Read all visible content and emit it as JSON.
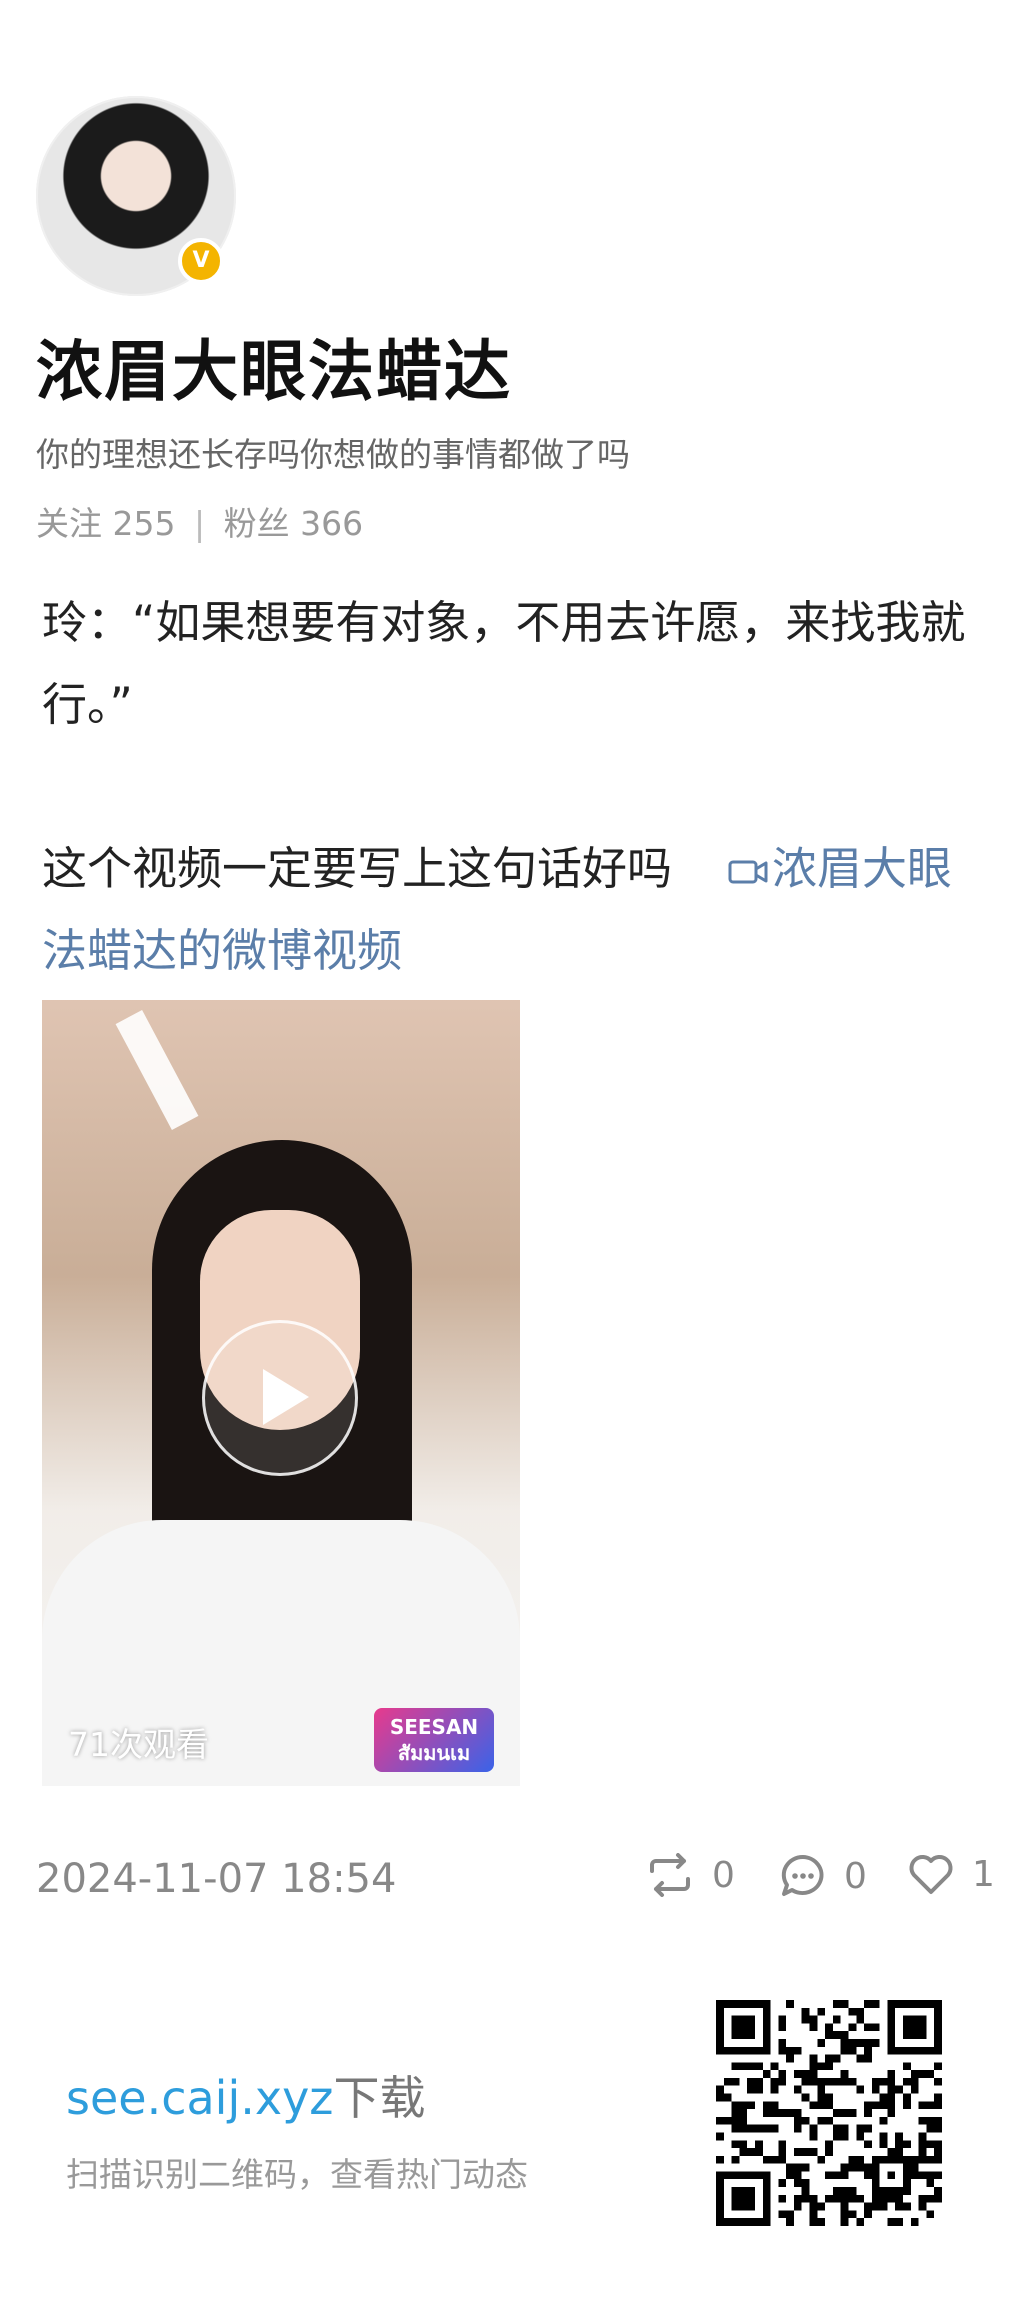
{
  "profile": {
    "name": "浓眉大眼法蜡达",
    "bio": "你的理想还长存吗你想做的事情都做了吗",
    "follow_label": "关注",
    "follow_count": "255",
    "separator": "|",
    "fans_label": "粉丝",
    "fans_count": "366",
    "verified_mark": "V"
  },
  "post": {
    "line1": "玲：“如果想要有对象，不用去许愿，来找我就行。”",
    "line2": "这个视频一定要写上这句话好吗",
    "video_link": "浓眉大眼法蜡达的微博视频"
  },
  "video": {
    "views": "71次观看",
    "badge": "SEESAN สัมมนเม"
  },
  "meta": {
    "date": "2024-11-07 18:54",
    "reposts": "0",
    "comments": "0",
    "likes": "1"
  },
  "footer": {
    "download_url": "see.caij.xyz",
    "download_label": "下载",
    "hint": "扫描识别二维码，查看热门动态"
  }
}
